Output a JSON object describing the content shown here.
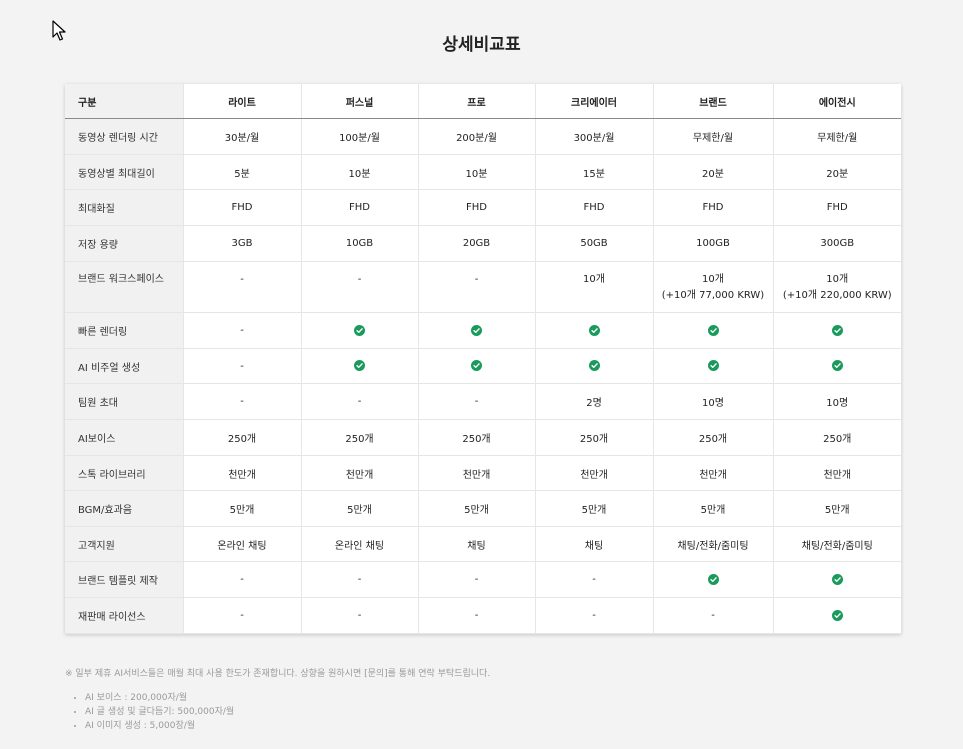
{
  "page": {
    "title": "상세비교표"
  },
  "table": {
    "headers": [
      "구분",
      "라이트",
      "퍼스널",
      "프로",
      "크리에이터",
      "브랜드",
      "에이전시"
    ],
    "rows": [
      {
        "label": "동영상 렌더링 시간",
        "height": 36,
        "cells": [
          "30분/월",
          "100분/월",
          "200분/월",
          "300분/월",
          "무제한/월",
          "무제한/월"
        ]
      },
      {
        "label": "동영상별 최대길이",
        "height": 35,
        "cells": [
          "5분",
          "10분",
          "10분",
          "15분",
          "20분",
          "20분"
        ]
      },
      {
        "label": "최대화질",
        "height": 36,
        "cells": [
          "FHD",
          "FHD",
          "FHD",
          "FHD",
          "FHD",
          "FHD"
        ]
      },
      {
        "label": "저장 용량",
        "height": 36,
        "cells": [
          "3GB",
          "10GB",
          "20GB",
          "50GB",
          "100GB",
          "300GB"
        ]
      },
      {
        "label": "브랜드 워크스페이스",
        "height": 51,
        "tall": true,
        "cells": [
          "-",
          "-",
          "-",
          "10개",
          "10개\n(+10개 77,000 KRW)",
          "10개\n(+10개 220,000 KRW)"
        ]
      },
      {
        "label": "빠른 렌더링",
        "height": 36,
        "cells": [
          "-",
          "check",
          "check",
          "check",
          "check",
          "check"
        ]
      },
      {
        "label": "AI 비주얼 생성",
        "height": 35,
        "cells": [
          "-",
          "check",
          "check",
          "check",
          "check",
          "check"
        ]
      },
      {
        "label": "팀원 초대",
        "height": 36,
        "cells": [
          "-",
          "-",
          "-",
          "2명",
          "10명",
          "10명"
        ]
      },
      {
        "label": "AI보이스",
        "height": 36,
        "cells": [
          "250개",
          "250개",
          "250개",
          "250개",
          "250개",
          "250개"
        ]
      },
      {
        "label": "스톡 라이브러리",
        "height": 35,
        "cells": [
          "천만개",
          "천만개",
          "천만개",
          "천만개",
          "천만개",
          "천만개"
        ]
      },
      {
        "label": "BGM/효과음",
        "height": 36,
        "cells": [
          "5만개",
          "5만개",
          "5만개",
          "5만개",
          "5만개",
          "5만개"
        ]
      },
      {
        "label": "고객지원",
        "height": 35,
        "cells": [
          "온라인 채팅",
          "온라인 채팅",
          "채팅",
          "채팅",
          "채팅/전화/줌미팅",
          "채팅/전화/줌미팅"
        ]
      },
      {
        "label": "브랜드 템플릿 제작",
        "height": 36,
        "cells": [
          "-",
          "-",
          "-",
          "-",
          "check",
          "check"
        ]
      },
      {
        "label": "재판매 라이선스",
        "height": 36,
        "cells": [
          "-",
          "-",
          "-",
          "-",
          "-",
          "check"
        ]
      }
    ]
  },
  "footer": {
    "note": "※ 일부 제휴 AI서비스들은 매월 최대 사용 한도가 존재합니다. 상향을 원하시면 [문의]를 통해 연락 부탁드립니다.",
    "items": [
      "AI 보이스 : 200,000자/월",
      "AI 글 생성 및 글다듬기: 500,000자/월",
      "AI 이미지 생성 : 5,000장/월"
    ]
  },
  "colors": {
    "check": "#1a9b5c",
    "label_bg": "#f1f1f1",
    "page_bg": "#f3f3f3"
  },
  "icons": {
    "check": "check-circle-icon",
    "cursor": "mouse-cursor-icon"
  }
}
